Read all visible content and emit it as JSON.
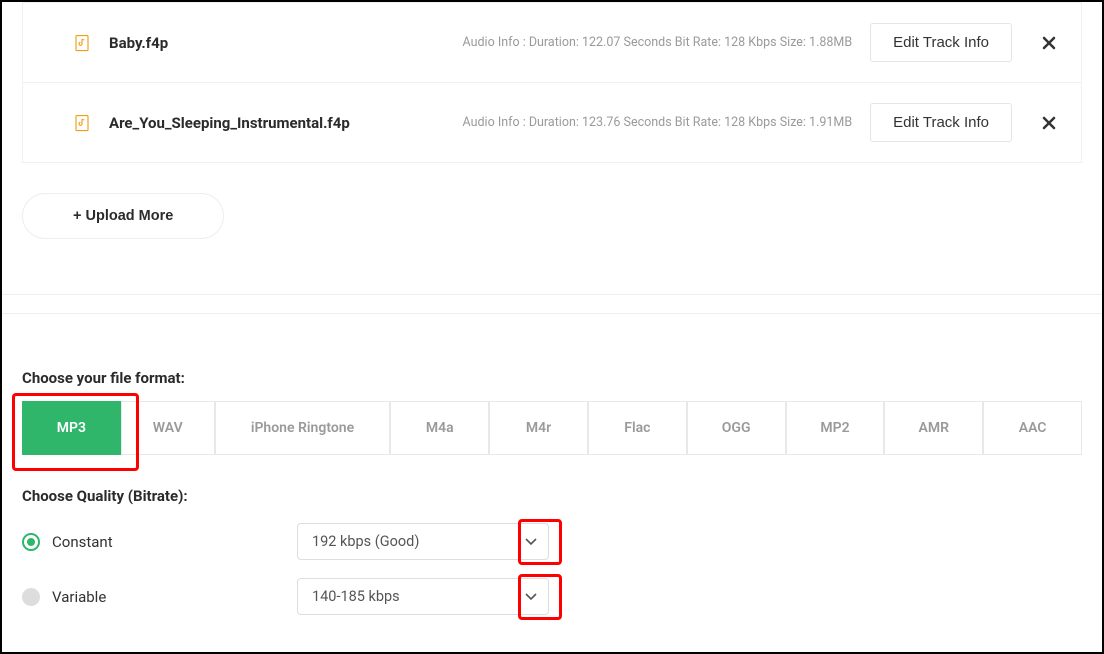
{
  "files": [
    {
      "name": "Baby.f4p",
      "info": "Audio Info : Duration: 122.07 Seconds Bit Rate: 128 Kbps Size: 1.88MB"
    },
    {
      "name": "Are_You_Sleeping_Instrumental.f4p",
      "info": "Audio Info : Duration: 123.76 Seconds Bit Rate: 128 Kbps Size: 1.91MB"
    }
  ],
  "edit_track_label": "Edit Track Info",
  "upload_more_label": "+ Upload More",
  "format_label": "Choose your file format:",
  "formats": [
    "MP3",
    "WAV",
    "iPhone Ringtone",
    "M4a",
    "M4r",
    "Flac",
    "OGG",
    "MP2",
    "AMR",
    "AAC"
  ],
  "format_widths": [
    99,
    94,
    176,
    99,
    99,
    99,
    99,
    99,
    99,
    99
  ],
  "quality_label": "Choose Quality (Bitrate):",
  "constant_label": "Constant",
  "variable_label": "Variable",
  "constant_value": "192 kbps (Good)",
  "variable_value": "140-185 kbps"
}
